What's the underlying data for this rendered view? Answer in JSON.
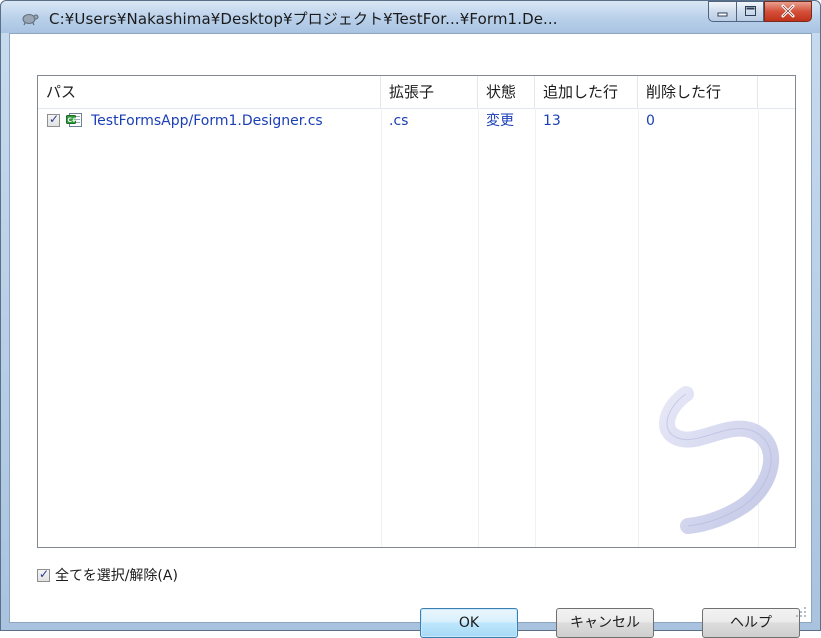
{
  "window": {
    "title": "C:¥Users¥Nakashima¥Desktop¥プロジェクト¥TestFor...¥Form1.De..."
  },
  "list": {
    "columns": [
      "パス",
      "拡張子",
      "状態",
      "追加した行",
      "削除した行"
    ],
    "rows": [
      {
        "checked": true,
        "path": "TestFormsApp/Form1.Designer.cs",
        "extension": ".cs",
        "status": "変更",
        "added": "13",
        "removed": "0",
        "icon": "csharp-file-icon"
      }
    ]
  },
  "select_all": {
    "label": "全てを選択/解除(A)",
    "checked": true
  },
  "buttons": {
    "ok": "OK",
    "cancel": "キャンセル",
    "help": "ヘルプ"
  },
  "colors": {
    "link_text": "#1a3fb5",
    "default_button": "#bee6fd"
  }
}
